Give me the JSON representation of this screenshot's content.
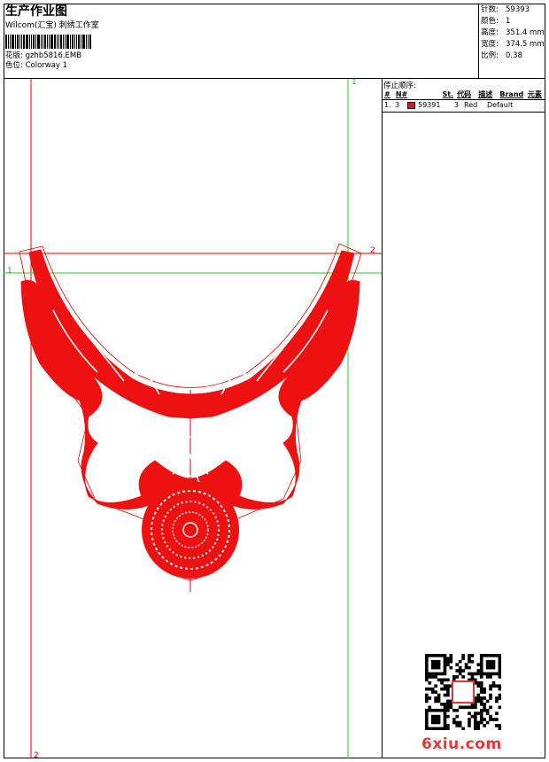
{
  "header": {
    "title": "生产作业图",
    "company": "Wilcom(汇宝) 刺绣工作室",
    "design_label": "花版:",
    "design_value": "gzhb5816.EMB",
    "color_label": "色位:",
    "color_value": "Colorway 1"
  },
  "stats": [
    {
      "label": "针数:",
      "value": "59393"
    },
    {
      "label": "颜色:",
      "value": "1"
    },
    {
      "label": "高度:",
      "value": "351.4 mm"
    },
    {
      "label": "宽度:",
      "value": "374.5 mm"
    },
    {
      "label": "比例:",
      "value": "0.38"
    }
  ],
  "stop_sequence": {
    "title": "停止顺序:",
    "headers": [
      "#",
      "N#",
      "St.",
      "代码",
      "描述",
      "Brand",
      "元素"
    ],
    "rows": [
      {
        "num": "1.",
        "n": "3",
        "color": "#ee1111",
        "stitches": "59391",
        "code": "3",
        "desc": "Red",
        "brand": "Default",
        "element": ""
      }
    ]
  },
  "guides": {
    "green_top": "1",
    "green_left": "1",
    "red_right": "2",
    "red_bottom": "2"
  },
  "embroidery_color": "#ee1111",
  "watermark": "6xiu.com"
}
